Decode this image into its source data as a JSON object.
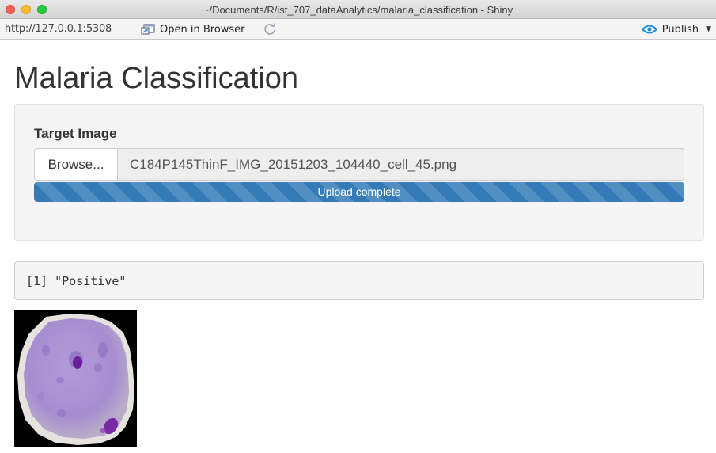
{
  "window": {
    "title": "~/Documents/R/ist_707_dataAnalytics/malaria_classification - Shiny"
  },
  "toolbar": {
    "url": "http://127.0.0.1:5308",
    "open_in_browser": "Open in Browser",
    "publish": "Publish"
  },
  "app": {
    "title": "Malaria Classification",
    "file_input": {
      "label": "Target Image",
      "button": "Browse...",
      "filename": "C184P145ThinF_IMG_20151203_104440_cell_45.png",
      "progress_text": "Upload complete",
      "progress_percent": 100
    },
    "output_text": "[1] \"Positive\""
  },
  "colors": {
    "progress": "#337ab7",
    "publish_icon": "#1b8fd8",
    "cell": "#a58ed0",
    "parasite": "#7b2aa6"
  },
  "icons": {
    "open_in_browser": "open-in-browser-icon",
    "reload": "reload-icon",
    "publish": "publish-icon"
  }
}
